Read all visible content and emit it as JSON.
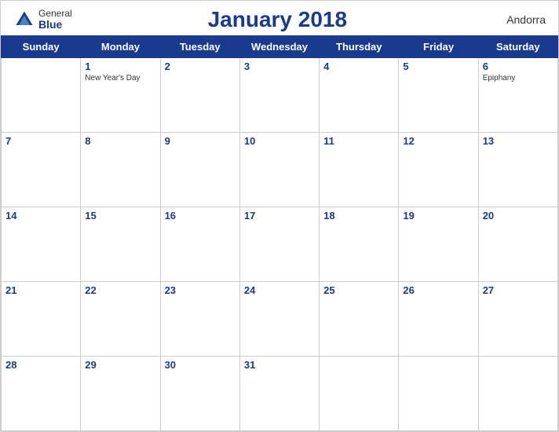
{
  "header": {
    "title": "January 2018",
    "country": "Andorra",
    "logo": {
      "general": "General",
      "blue": "Blue"
    }
  },
  "days_of_week": [
    "Sunday",
    "Monday",
    "Tuesday",
    "Wednesday",
    "Thursday",
    "Friday",
    "Saturday"
  ],
  "weeks": [
    [
      {
        "day": "",
        "holiday": ""
      },
      {
        "day": "1",
        "holiday": "New Year's Day"
      },
      {
        "day": "2",
        "holiday": ""
      },
      {
        "day": "3",
        "holiday": ""
      },
      {
        "day": "4",
        "holiday": ""
      },
      {
        "day": "5",
        "holiday": ""
      },
      {
        "day": "6",
        "holiday": "Epiphany"
      }
    ],
    [
      {
        "day": "7",
        "holiday": ""
      },
      {
        "day": "8",
        "holiday": ""
      },
      {
        "day": "9",
        "holiday": ""
      },
      {
        "day": "10",
        "holiday": ""
      },
      {
        "day": "11",
        "holiday": ""
      },
      {
        "day": "12",
        "holiday": ""
      },
      {
        "day": "13",
        "holiday": ""
      }
    ],
    [
      {
        "day": "14",
        "holiday": ""
      },
      {
        "day": "15",
        "holiday": ""
      },
      {
        "day": "16",
        "holiday": ""
      },
      {
        "day": "17",
        "holiday": ""
      },
      {
        "day": "18",
        "holiday": ""
      },
      {
        "day": "19",
        "holiday": ""
      },
      {
        "day": "20",
        "holiday": ""
      }
    ],
    [
      {
        "day": "21",
        "holiday": ""
      },
      {
        "day": "22",
        "holiday": ""
      },
      {
        "day": "23",
        "holiday": ""
      },
      {
        "day": "24",
        "holiday": ""
      },
      {
        "day": "25",
        "holiday": ""
      },
      {
        "day": "26",
        "holiday": ""
      },
      {
        "day": "27",
        "holiday": ""
      }
    ],
    [
      {
        "day": "28",
        "holiday": ""
      },
      {
        "day": "29",
        "holiday": ""
      },
      {
        "day": "30",
        "holiday": ""
      },
      {
        "day": "31",
        "holiday": ""
      },
      {
        "day": "",
        "holiday": ""
      },
      {
        "day": "",
        "holiday": ""
      },
      {
        "day": "",
        "holiday": ""
      }
    ]
  ]
}
